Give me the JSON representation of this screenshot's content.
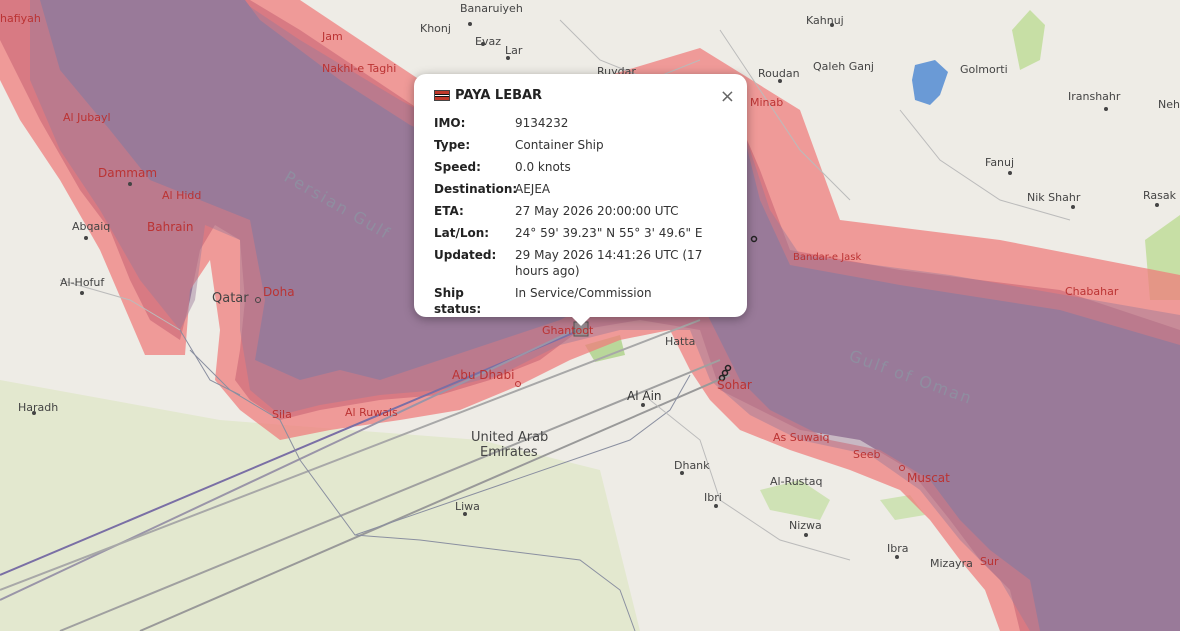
{
  "map": {
    "labels": {
      "banaruiyeh": "Banaruiyeh",
      "khonj": "Khonj",
      "evaz": "Evaz",
      "lar": "Lar",
      "ruydar": "Ruydar",
      "kahnuj": "Kahnuj",
      "roudan": "Roudan",
      "qaleh_ganj": "Qaleh Ganj",
      "golmorti": "Golmorti",
      "iranshahr": "Iranshahr",
      "nehe": "Nehe",
      "jam": "Jam",
      "nakhl_e_taghi": "Nakhl-e Taghi",
      "minab": "Minab",
      "fanuj": "Fanuj",
      "nik_shahr": "Nik Shahr",
      "rasak": "Rasak",
      "al_jubayl": "Al Jubayl",
      "dammam": "Dammam",
      "al_hidd": "Al Hidd",
      "bahrain": "Bahrain",
      "abqaiq": "Abqaiq",
      "al_hofuf": "Al-Hofuf",
      "qatar": "Qatar",
      "doha": "Doha",
      "haradh": "Haradh",
      "sila": "Sila",
      "al_ruwais": "Al Ruwais",
      "abu_dhabi": "Abu Dhabi",
      "ghantoot": "Ghantoot",
      "hatta": "Hatta",
      "al_ain": "Al Ain",
      "uae1": "United Arab",
      "uae2": "Emirates",
      "sohar": "Sohar",
      "as_suwaiq": "As Suwaiq",
      "seeb": "Seeb",
      "muscat": "Muscat",
      "dhank": "Dhank",
      "ibri": "Ibri",
      "al_rustaq": "Al-Rustaq",
      "nizwa": "Nizwa",
      "ibra": "Ibra",
      "mizayra": "Mizayra",
      "sur": "Sur",
      "liwa": "Liwa",
      "bandar_e_jask": "Bandar-e Jask",
      "chabahar": "Chabahar",
      "persian_gulf": "Persian Gulf",
      "gulf_of_oman": "Gulf of Oman",
      "hafar": "hafiyah"
    }
  },
  "popup": {
    "ship_name": "PAYA LEBAR",
    "close_symbol": "×",
    "flag_icon": "antigua-and-barbuda-flag",
    "rows": [
      {
        "label": "IMO:",
        "value": "9134232"
      },
      {
        "label": "Type:",
        "value": "Container Ship"
      },
      {
        "label": "Speed:",
        "value": "0.0 knots"
      },
      {
        "label": "Destination:",
        "value": "AEJEA"
      },
      {
        "label": "ETA:",
        "value": "27 May 2026 20:00:00 UTC"
      },
      {
        "label": "Lat/Lon:",
        "value": "24° 59' 39.23\" N 55° 3' 49.6\" E"
      },
      {
        "label": "Updated:",
        "value": "29 May 2026 14:41:26 UTC (17 hours ago)"
      },
      {
        "label": "Ship status:",
        "value": "In Service/Commission"
      }
    ]
  },
  "colors": {
    "sea": "#9a7a9a",
    "zone": "#f08a8a",
    "land": "#eeece6",
    "accent_text": "#b33333"
  }
}
